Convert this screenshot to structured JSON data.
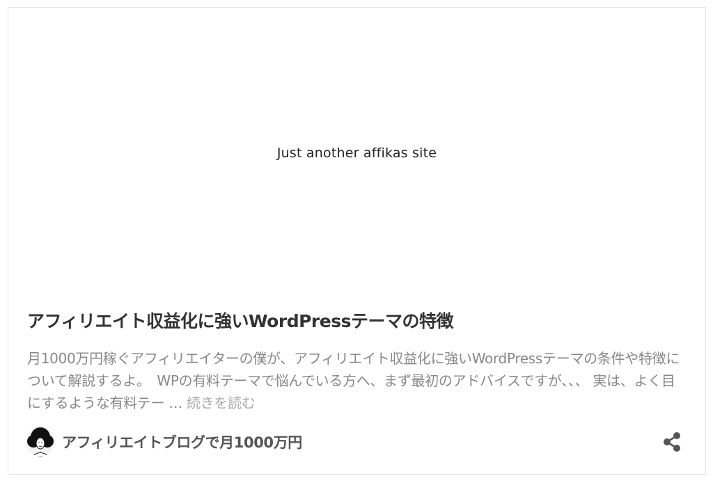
{
  "card": {
    "thumbnail_text": "Just another affikas site",
    "title": "アフィリエイト収益化に強いWordPressテーマの特徴",
    "excerpt": "月1000万円稼ぐアフィリエイターの僕が、アフィリエイト収益化に強いWordPressテーマの条件や特徴について解説するよ。　WPの有料テーマで悩んでいる方へ、まず最初のアドバイスですが、、、 実は、よく目にするような有料テー … ",
    "read_more": "続きを読む",
    "author": {
      "name": "アフィリエイトブログで月1000万円",
      "avatar_icon": "avatar-afro-icon"
    },
    "share_icon": "share-icon",
    "colors": {
      "title": "#333333",
      "excerpt": "#888888",
      "read_more": "#aaaaaa",
      "share": "#555555"
    }
  }
}
